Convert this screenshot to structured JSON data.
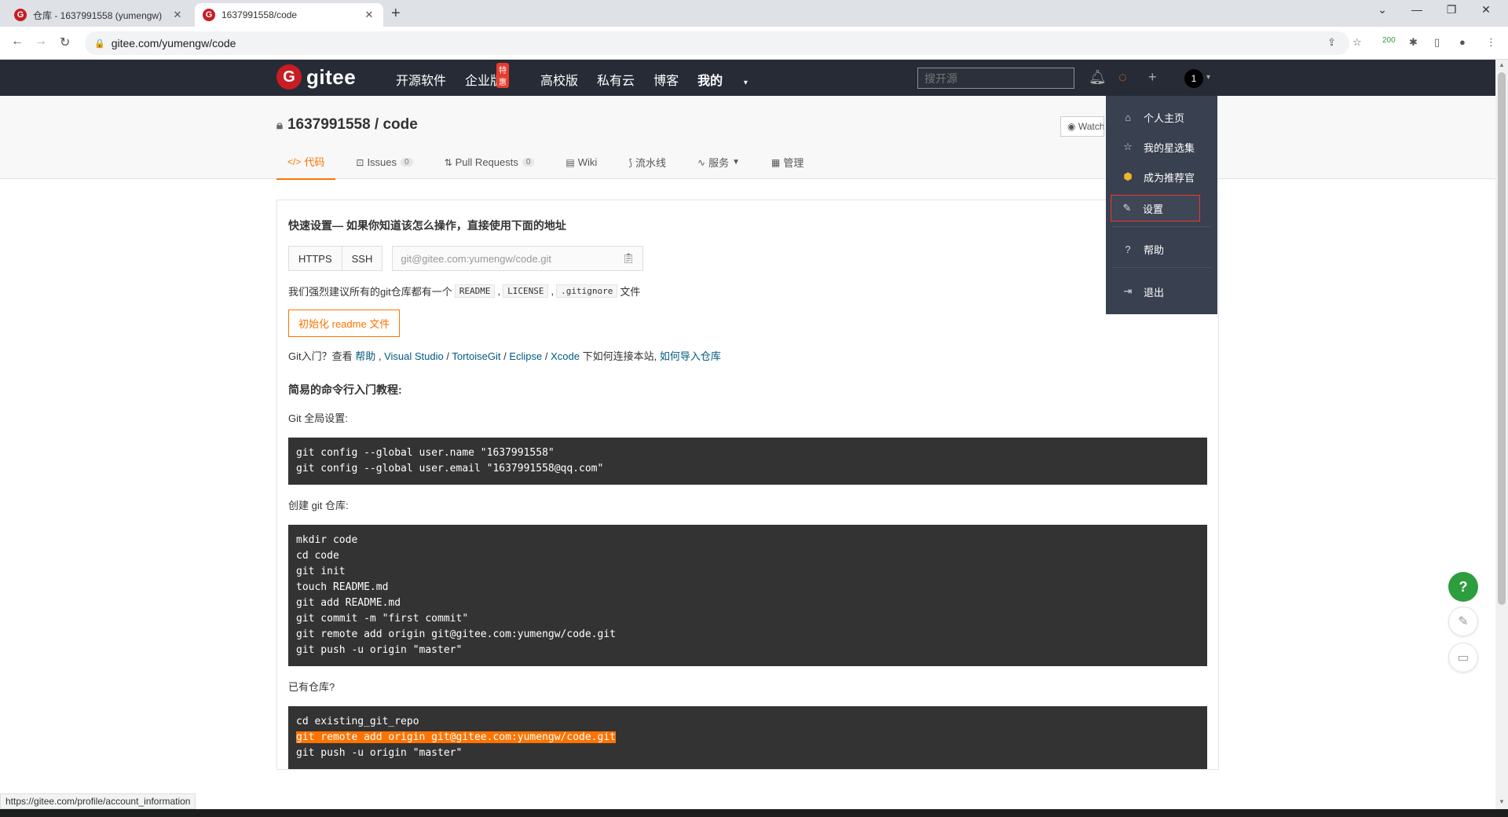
{
  "browser": {
    "tabs": [
      {
        "title": "仓库 - 1637991558 (yumengw)",
        "active": false
      },
      {
        "title": "1637991558/code",
        "active": true
      }
    ],
    "url": "gitee.com/yumengw/code",
    "ext_badge": "200"
  },
  "header": {
    "logo_text": "gitee",
    "nav": [
      "开源软件",
      "企业版",
      "高校版",
      "私有云",
      "博客",
      "我的"
    ],
    "nav_badge": "特惠",
    "search_placeholder": "搜开源",
    "avatar_text": "1"
  },
  "repo": {
    "title": "1637991558 / code",
    "watch_label": "Watch",
    "tabs": [
      {
        "label": "代码",
        "count": ""
      },
      {
        "label": "Issues",
        "count": "0"
      },
      {
        "label": "Pull Requests",
        "count": "0"
      },
      {
        "label": "Wiki",
        "count": ""
      },
      {
        "label": "流水线",
        "count": ""
      },
      {
        "label": "服务",
        "count": ""
      },
      {
        "label": "管理",
        "count": ""
      }
    ]
  },
  "main": {
    "quick_title": "快速设置— 如果你知道该怎么操作，直接使用下面的地址",
    "protocols": [
      "HTTPS",
      "SSH"
    ],
    "clone_url": "git@gitee.com:yumengw/code.git",
    "recommend_prefix": "我们强烈建议所有的git仓库都有一个",
    "recommend_files": [
      "README",
      "LICENSE",
      ".gitignore"
    ],
    "recommend_suffix": "文件",
    "init_button": "初始化 readme 文件",
    "gitintro": {
      "prefix": "Git入门？查看 ",
      "help": "帮助",
      "tools": [
        "Visual Studio",
        "TortoiseGit",
        "Eclipse",
        "Xcode"
      ],
      "middle": " 下如何连接本站, ",
      "import": "如何导入仓库"
    },
    "tutorial_title": "简易的命令行入门教程:",
    "sections": [
      {
        "label": "Git 全局设置:",
        "code": [
          "git config --global user.name \"1637991558\"",
          "git config --global user.email \"1637991558@qq.com\""
        ]
      },
      {
        "label": "创建 git 仓库:",
        "code": [
          "mkdir code",
          "cd code",
          "git init",
          "touch README.md",
          "git add README.md",
          "git commit -m \"first commit\"",
          "git remote add origin git@gitee.com:yumengw/code.git",
          "git push -u origin \"master\""
        ]
      },
      {
        "label": "已有仓库?",
        "code": [
          "cd existing_git_repo",
          "git remote add origin git@gitee.com:yumengw/code.git",
          "git push -u origin \"master\""
        ],
        "highlight_line": 1
      }
    ]
  },
  "dropdown": {
    "items": [
      {
        "label": "个人主页",
        "icon": "home-icon"
      },
      {
        "label": "我的星选集",
        "icon": "star-icon"
      },
      {
        "label": "成为推荐官",
        "icon": "medal-icon"
      },
      {
        "label": "设置",
        "icon": "edit-icon"
      },
      {
        "label": "帮助",
        "icon": "help-circle-icon"
      },
      {
        "label": "退出",
        "icon": "logout-icon"
      }
    ]
  },
  "status_url": "https://gitee.com/profile/account_information",
  "fab_help": "?",
  "colors": {
    "accent": "#fe7300",
    "header_bg": "#262b36",
    "dropdown_bg": "#394050",
    "brand_red": "#c71d23",
    "help_green": "#2d9d3e"
  }
}
